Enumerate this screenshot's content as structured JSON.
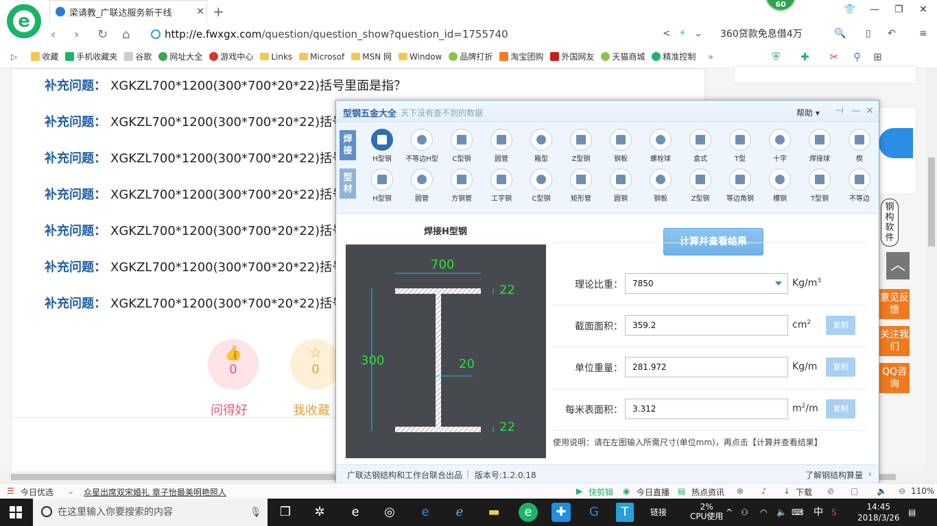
{
  "browser": {
    "tab_title": "梁请教_广联达服务新干线",
    "badge_count": "60",
    "url_host": "http://e.fwxgx.com",
    "url_path": "/question/question_show?question_id=1755740",
    "search_text": "360贷款免息借4万",
    "bookmarks": [
      "收藏",
      "手机收藏夹",
      "谷歌",
      "网址大全",
      "游戏中心",
      "Links",
      "Microsof",
      "MSN 网",
      "Window",
      "品牌打折",
      "淘宝团购",
      "外国网友",
      "天猫商城",
      "精准控制"
    ]
  },
  "page": {
    "q_label": "补充问题：",
    "questions": [
      "XGKZL700*1200(300*700*20*22)括号里面是指？",
      "XGKZL700*1200(300*700*20*22)括号里",
      "XGKZL700*1200(300*700*20*22)括号里",
      "XGKZL700*1200(300*700*20*22)括号里",
      "XGKZL700*1200(300*700*20*22)括号里",
      "XGKZL700*1200(300*700*20*22)括号里",
      "XGKZL700*1200(300*700*20*22)括号里"
    ],
    "like_count": "0",
    "fav_count": "0",
    "like_label": "问得好",
    "fav_label": "我收藏",
    "float_feedback": "意见反馈",
    "float_follow": "关注我们",
    "float_qq": "QQ咨询",
    "side_text": "钢构软件"
  },
  "dialog": {
    "title": "型钢五金大全",
    "subtitle": "天下没有查不到的数据",
    "help": "帮助",
    "tab_weld": "焊接",
    "tab_profile": "型材",
    "weld_items": [
      "H型钢",
      "不等边H型",
      "C型钢",
      "圆管",
      "箱型",
      "Z型钢",
      "钢板",
      "螺栓球",
      "盒式",
      "T型",
      "十字",
      "焊接球",
      "楔"
    ],
    "profile_items": [
      "H型钢",
      "圆管",
      "方钢管",
      "工字钢",
      "C型钢",
      "矩形管",
      "圆钢",
      "钢板",
      "Z型钢",
      "等边角钢",
      "槽钢",
      "T型钢",
      "不等边"
    ],
    "diagram_title": "焊接H型钢",
    "dims": {
      "width": "700",
      "height": "300",
      "web": "20",
      "flange_top": "22",
      "flange_bot": "22"
    },
    "calc_button": "计算并查看结果",
    "fields": [
      {
        "label": "理论比重：",
        "value": "7850",
        "unit": "Kg/m",
        "sup": "3",
        "copy": ""
      },
      {
        "label": "截面面积：",
        "value": "359.2",
        "unit": "cm",
        "sup": "2",
        "copy": "复制"
      },
      {
        "label": "单位重量：",
        "value": "281.972",
        "unit": "Kg/m",
        "sup": "",
        "copy": "复制"
      },
      {
        "label": "每米表面积：",
        "value": "3.312",
        "unit": "m/m",
        "sup": "2",
        "copy": "复制"
      }
    ],
    "note": "使用说明：请在左图输入所需尺寸(单位mm)，再点击【计算并查看结果】",
    "footer_left": "广联达钢结构和工作台联合出品",
    "version": "版本号:1.2.0.18",
    "footer_right": "了解钢结构算量"
  },
  "statusbar": {
    "today": "今日优选",
    "news": "众星出席双宋婚礼 章子怡最美明艳照人",
    "kuaijian": "快剪辑",
    "zhibo": "今日直播",
    "redian": "热点资讯",
    "download": "下载",
    "zoom": "110%"
  },
  "taskbar": {
    "search_placeholder": "在这里输入你要搜索的内容",
    "links": "链接",
    "cpu_pct": "2%",
    "cpu_label": "CPU使用",
    "ime": "中",
    "time": "14:45",
    "date": "2018/3/26"
  }
}
